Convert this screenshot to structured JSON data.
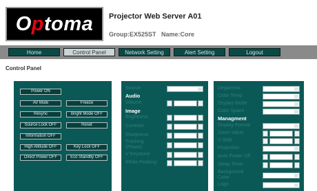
{
  "header": {
    "logo_text": "Optoma",
    "title": "Projector Web Server A01",
    "group_label": "Group:EX525ST",
    "name_label": "Name:Core"
  },
  "nav": {
    "home": "Home",
    "control_panel": "Control Panel",
    "network_setting": "Network Setting",
    "alert_setting": "Alert Setting",
    "logout": "Logout",
    "active": "Control Panel"
  },
  "page": {
    "section_title": "Control Panel"
  },
  "buttons": {
    "power_on": "Power ON",
    "av_mute": "AV Mute",
    "freeze": "Freeze",
    "resync": "Resync",
    "bright_mode_off": "Bright Mode OFF",
    "source_lock_off": "Source Lock OFF",
    "reset": "Reset",
    "information_off": "Information OFF",
    "high_altitude_off": "High Altitude OFF",
    "key_lock_off": "Key Lock OFF",
    "direct_power_off": "Direct Power OFF",
    "eco_standby_off": "Eco Standby OFF"
  },
  "middle": {
    "source": "Source",
    "audio": "Audio",
    "volume": "Volume",
    "image": "Image",
    "brightness": "Brightness",
    "contrast": "Contrast",
    "sharpness": "Sharpness",
    "tracking_1": "Tracking",
    "tracking_2": "(Phase)",
    "v_keystone": "V Keystone",
    "white_peaking": "White Peaking"
  },
  "right": {
    "degamma": "Degamma",
    "color_temp": "Color Temp",
    "display_mode": "Display Mode",
    "color_space": "Color Space",
    "management": "Managment",
    "display_format": "Display Format",
    "zoom_value": "Zoom Value",
    "v_shift": "V Shift",
    "projection": "Projection",
    "auto_power_off": "Auto Power Off",
    "sleep_timer": "Sleep Timer",
    "background_1": "Background",
    "background_2": "Color",
    "logo": "Logo"
  },
  "colors": {
    "panel": "#0b5957",
    "nav_bar": "#8a8a8a",
    "nav_button": "#0a4a46",
    "logo_accent": "#e30613"
  }
}
